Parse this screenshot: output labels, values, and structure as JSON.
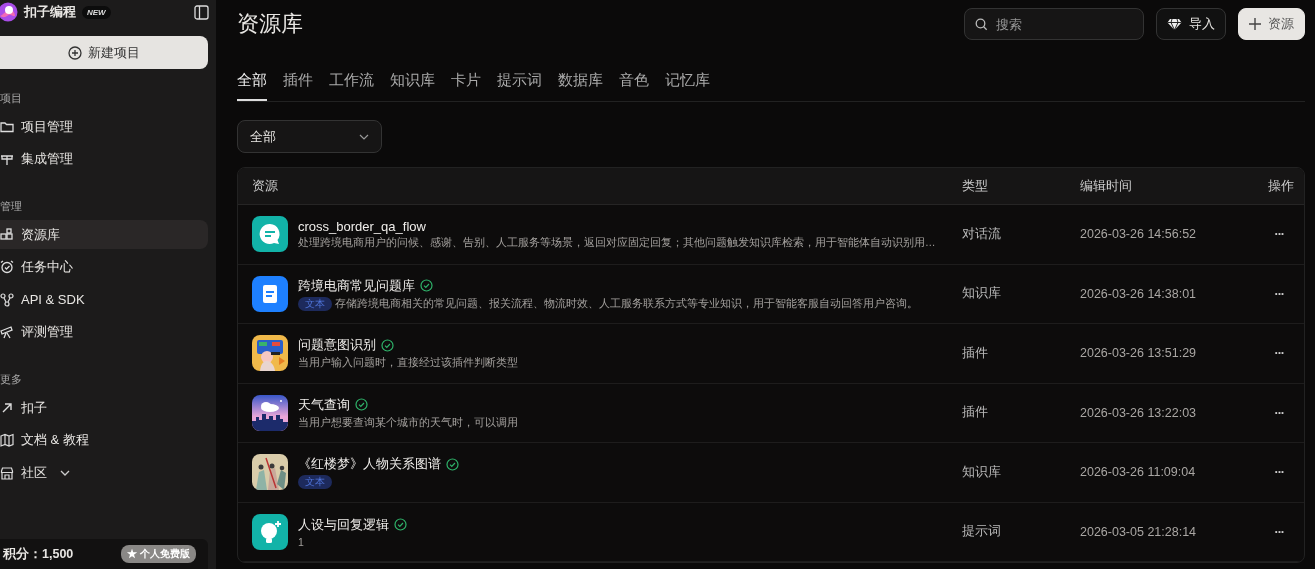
{
  "sidebar": {
    "brand": "扣子编程",
    "brand_badge": "NEW",
    "new_button": "新建项目",
    "sections": [
      {
        "title": "项目",
        "items": [
          {
            "label": "项目管理",
            "selected": false
          },
          {
            "label": "集成管理",
            "selected": false
          }
        ]
      },
      {
        "title": "管理",
        "items": [
          {
            "label": "资源库",
            "selected": true
          },
          {
            "label": "任务中心",
            "selected": false
          },
          {
            "label": "API & SDK",
            "selected": false
          },
          {
            "label": "评测管理",
            "selected": false
          }
        ]
      },
      {
        "title": "更多",
        "items": [
          {
            "label": "扣子",
            "selected": false
          },
          {
            "label": "文档 & 教程",
            "selected": false
          },
          {
            "label": "社区",
            "selected": false,
            "expanded": false
          }
        ]
      }
    ],
    "points": "积分：1,500",
    "plan_badge": "★ 个人免费版"
  },
  "header": {
    "title": "资源库",
    "search": {
      "placeholder": "搜索"
    },
    "import_button": "导入",
    "add_button": "资源"
  },
  "tabs": [
    {
      "label": "全部",
      "selected": true
    },
    {
      "label": "插件",
      "selected": false
    },
    {
      "label": "工作流",
      "selected": false
    },
    {
      "label": "知识库",
      "selected": false
    },
    {
      "label": "卡片",
      "selected": false
    },
    {
      "label": "提示词",
      "selected": false
    },
    {
      "label": "数据库",
      "selected": false
    },
    {
      "label": "音色",
      "selected": false
    },
    {
      "label": "记忆库",
      "selected": false
    }
  ],
  "filter": {
    "value": "全部"
  },
  "table": {
    "columns": [
      "资源",
      "类型",
      "编辑时间",
      "操作"
    ],
    "rows": [
      {
        "kind": "chat",
        "name": "cross_border_qa_flow",
        "verified": false,
        "description": "处理跨境电商用户的问候、感谢、告别、人工服务等场景，返回对应固定回复；其他问题触发知识库检索，用于智能体自动识别用…",
        "type": "对话流",
        "time": "2026-03-26 14:56:52",
        "action": "···"
      },
      {
        "kind": "document",
        "name": "跨境电商常见问题库",
        "verified": true,
        "tag": "文本",
        "description": "存储跨境电商相关的常见问题、报关流程、物流时效、人工服务联系方式等专业知识，用于智能客服自动回答用户咨询。",
        "type": "知识库",
        "time": "2026-03-26 14:38:01",
        "action": "···"
      },
      {
        "kind": "picture",
        "name": "问题意图识别",
        "verified": true,
        "description": "当用户输入问题时，直接经过该插件判断类型",
        "type": "插件",
        "time": "2026-03-26 13:51:29",
        "action": "···"
      },
      {
        "kind": "picture",
        "name": "天气查询",
        "verified": true,
        "description": "当用户想要查询某个城市的天气时，可以调用",
        "type": "插件",
        "time": "2026-03-26 13:22:03",
        "action": "···"
      },
      {
        "kind": "picture",
        "name": "《红楼梦》人物关系图谱",
        "verified": true,
        "tag": "文本",
        "type": "知识库",
        "time": "2026-03-26 11:09:04",
        "action": "···"
      },
      {
        "kind": "bulb",
        "name": "人设与回复逻辑",
        "verified": true,
        "description": "1",
        "type": "提示词",
        "time": "2026-03-05 21:28:14",
        "action": "···"
      }
    ]
  }
}
